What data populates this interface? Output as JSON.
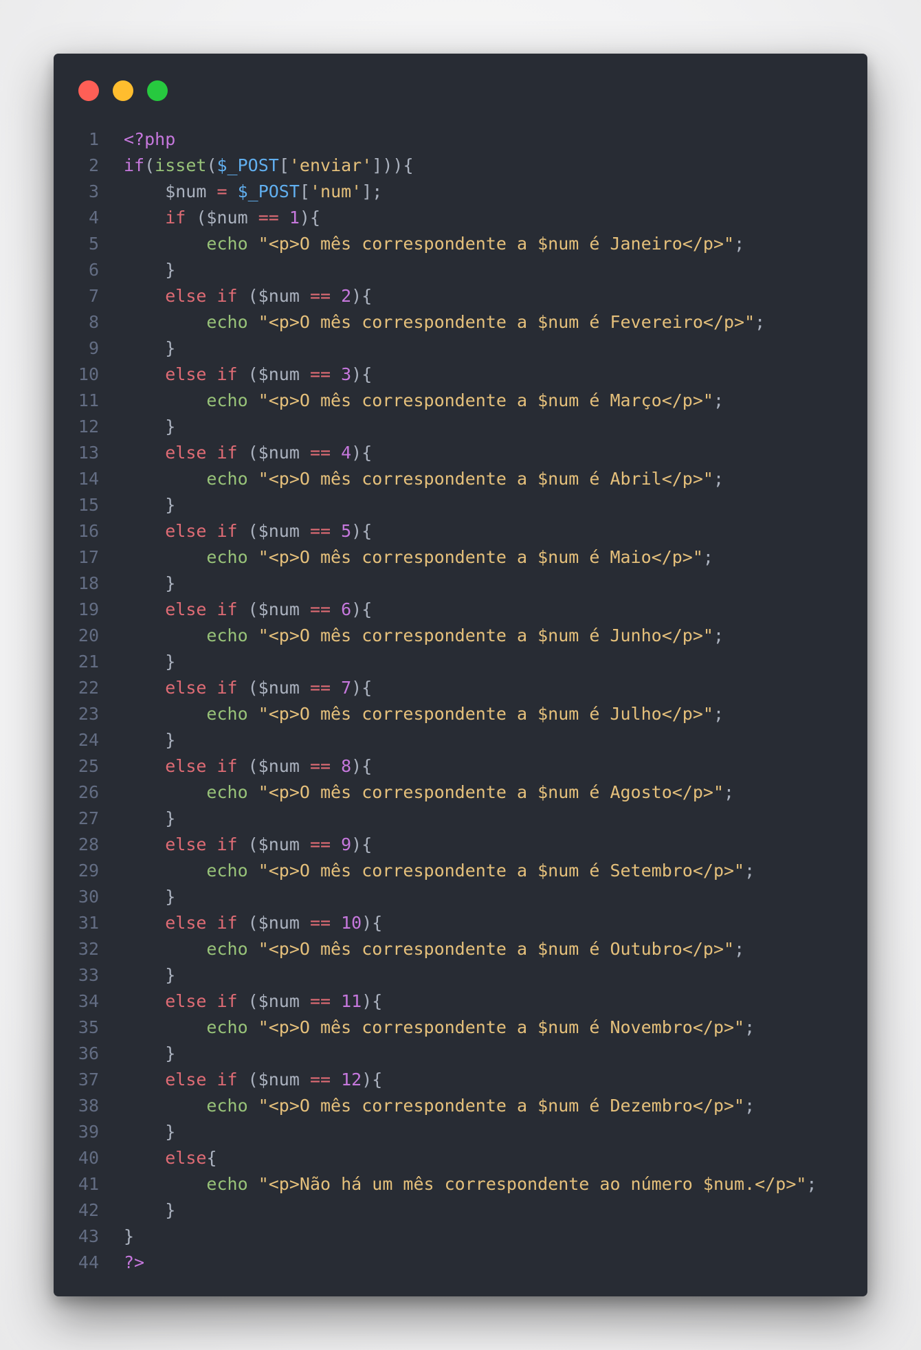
{
  "window": {
    "controls": [
      {
        "name": "close",
        "color": "#ff5f56"
      },
      {
        "name": "minimize",
        "color": "#ffbd2e"
      },
      {
        "name": "maximize",
        "color": "#27c93f"
      }
    ]
  },
  "code": {
    "lines": [
      {
        "n": "1",
        "tokens": [
          {
            "t": "<?php",
            "c": "purple"
          }
        ]
      },
      {
        "n": "2",
        "tokens": [
          {
            "t": "if",
            "c": "purple"
          },
          {
            "t": "(",
            "c": "plain"
          },
          {
            "t": "isset",
            "c": "fn"
          },
          {
            "t": "(",
            "c": "plain"
          },
          {
            "t": "$_POST",
            "c": "var"
          },
          {
            "t": "[",
            "c": "plain"
          },
          {
            "t": "'enviar'",
            "c": "str"
          },
          {
            "t": "])){",
            "c": "plain"
          }
        ]
      },
      {
        "n": "3",
        "tokens": [
          {
            "t": "    $num ",
            "c": "plain"
          },
          {
            "t": "=",
            "c": "kw"
          },
          {
            "t": " ",
            "c": "plain"
          },
          {
            "t": "$_POST",
            "c": "var"
          },
          {
            "t": "[",
            "c": "plain"
          },
          {
            "t": "'num'",
            "c": "str"
          },
          {
            "t": "];",
            "c": "plain"
          }
        ]
      },
      {
        "n": "4",
        "tokens": [
          {
            "t": "    ",
            "c": "plain"
          },
          {
            "t": "if",
            "c": "kw"
          },
          {
            "t": " ($num ",
            "c": "plain"
          },
          {
            "t": "==",
            "c": "kw"
          },
          {
            "t": " ",
            "c": "plain"
          },
          {
            "t": "1",
            "c": "num"
          },
          {
            "t": "){",
            "c": "plain"
          }
        ]
      },
      {
        "n": "5",
        "tokens": [
          {
            "t": "        ",
            "c": "plain"
          },
          {
            "t": "echo",
            "c": "fn"
          },
          {
            "t": " ",
            "c": "plain"
          },
          {
            "t": "\"<p>O mês correspondente a $num é Janeiro</p>\"",
            "c": "str"
          },
          {
            "t": ";",
            "c": "plain"
          }
        ]
      },
      {
        "n": "6",
        "tokens": [
          {
            "t": "    }",
            "c": "plain"
          }
        ]
      },
      {
        "n": "7",
        "tokens": [
          {
            "t": "    ",
            "c": "plain"
          },
          {
            "t": "else if",
            "c": "kw"
          },
          {
            "t": " ($num ",
            "c": "plain"
          },
          {
            "t": "==",
            "c": "kw"
          },
          {
            "t": " ",
            "c": "plain"
          },
          {
            "t": "2",
            "c": "num"
          },
          {
            "t": "){",
            "c": "plain"
          }
        ]
      },
      {
        "n": "8",
        "tokens": [
          {
            "t": "        ",
            "c": "plain"
          },
          {
            "t": "echo",
            "c": "fn"
          },
          {
            "t": " ",
            "c": "plain"
          },
          {
            "t": "\"<p>O mês correspondente a $num é Fevereiro</p>\"",
            "c": "str"
          },
          {
            "t": ";",
            "c": "plain"
          }
        ]
      },
      {
        "n": "9",
        "tokens": [
          {
            "t": "    }",
            "c": "plain"
          }
        ]
      },
      {
        "n": "10",
        "tokens": [
          {
            "t": "    ",
            "c": "plain"
          },
          {
            "t": "else if",
            "c": "kw"
          },
          {
            "t": " ($num ",
            "c": "plain"
          },
          {
            "t": "==",
            "c": "kw"
          },
          {
            "t": " ",
            "c": "plain"
          },
          {
            "t": "3",
            "c": "num"
          },
          {
            "t": "){",
            "c": "plain"
          }
        ]
      },
      {
        "n": "11",
        "tokens": [
          {
            "t": "        ",
            "c": "plain"
          },
          {
            "t": "echo",
            "c": "fn"
          },
          {
            "t": " ",
            "c": "plain"
          },
          {
            "t": "\"<p>O mês correspondente a $num é Março</p>\"",
            "c": "str"
          },
          {
            "t": ";",
            "c": "plain"
          }
        ]
      },
      {
        "n": "12",
        "tokens": [
          {
            "t": "    }",
            "c": "plain"
          }
        ]
      },
      {
        "n": "13",
        "tokens": [
          {
            "t": "    ",
            "c": "plain"
          },
          {
            "t": "else if",
            "c": "kw"
          },
          {
            "t": " ($num ",
            "c": "plain"
          },
          {
            "t": "==",
            "c": "kw"
          },
          {
            "t": " ",
            "c": "plain"
          },
          {
            "t": "4",
            "c": "num"
          },
          {
            "t": "){",
            "c": "plain"
          }
        ]
      },
      {
        "n": "14",
        "tokens": [
          {
            "t": "        ",
            "c": "plain"
          },
          {
            "t": "echo",
            "c": "fn"
          },
          {
            "t": " ",
            "c": "plain"
          },
          {
            "t": "\"<p>O mês correspondente a $num é Abril</p>\"",
            "c": "str"
          },
          {
            "t": ";",
            "c": "plain"
          }
        ]
      },
      {
        "n": "15",
        "tokens": [
          {
            "t": "    }",
            "c": "plain"
          }
        ]
      },
      {
        "n": "16",
        "tokens": [
          {
            "t": "    ",
            "c": "plain"
          },
          {
            "t": "else if",
            "c": "kw"
          },
          {
            "t": " ($num ",
            "c": "plain"
          },
          {
            "t": "==",
            "c": "kw"
          },
          {
            "t": " ",
            "c": "plain"
          },
          {
            "t": "5",
            "c": "num"
          },
          {
            "t": "){",
            "c": "plain"
          }
        ]
      },
      {
        "n": "17",
        "tokens": [
          {
            "t": "        ",
            "c": "plain"
          },
          {
            "t": "echo",
            "c": "fn"
          },
          {
            "t": " ",
            "c": "plain"
          },
          {
            "t": "\"<p>O mês correspondente a $num é Maio</p>\"",
            "c": "str"
          },
          {
            "t": ";",
            "c": "plain"
          }
        ]
      },
      {
        "n": "18",
        "tokens": [
          {
            "t": "    }",
            "c": "plain"
          }
        ]
      },
      {
        "n": "19",
        "tokens": [
          {
            "t": "    ",
            "c": "plain"
          },
          {
            "t": "else if",
            "c": "kw"
          },
          {
            "t": " ($num ",
            "c": "plain"
          },
          {
            "t": "==",
            "c": "kw"
          },
          {
            "t": " ",
            "c": "plain"
          },
          {
            "t": "6",
            "c": "num"
          },
          {
            "t": "){",
            "c": "plain"
          }
        ]
      },
      {
        "n": "20",
        "tokens": [
          {
            "t": "        ",
            "c": "plain"
          },
          {
            "t": "echo",
            "c": "fn"
          },
          {
            "t": " ",
            "c": "plain"
          },
          {
            "t": "\"<p>O mês correspondente a $num é Junho</p>\"",
            "c": "str"
          },
          {
            "t": ";",
            "c": "plain"
          }
        ]
      },
      {
        "n": "21",
        "tokens": [
          {
            "t": "    }",
            "c": "plain"
          }
        ]
      },
      {
        "n": "22",
        "tokens": [
          {
            "t": "    ",
            "c": "plain"
          },
          {
            "t": "else if",
            "c": "kw"
          },
          {
            "t": " ($num ",
            "c": "plain"
          },
          {
            "t": "==",
            "c": "kw"
          },
          {
            "t": " ",
            "c": "plain"
          },
          {
            "t": "7",
            "c": "num"
          },
          {
            "t": "){",
            "c": "plain"
          }
        ]
      },
      {
        "n": "23",
        "tokens": [
          {
            "t": "        ",
            "c": "plain"
          },
          {
            "t": "echo",
            "c": "fn"
          },
          {
            "t": " ",
            "c": "plain"
          },
          {
            "t": "\"<p>O mês correspondente a $num é Julho</p>\"",
            "c": "str"
          },
          {
            "t": ";",
            "c": "plain"
          }
        ]
      },
      {
        "n": "24",
        "tokens": [
          {
            "t": "    }",
            "c": "plain"
          }
        ]
      },
      {
        "n": "25",
        "tokens": [
          {
            "t": "    ",
            "c": "plain"
          },
          {
            "t": "else if",
            "c": "kw"
          },
          {
            "t": " ($num ",
            "c": "plain"
          },
          {
            "t": "==",
            "c": "kw"
          },
          {
            "t": " ",
            "c": "plain"
          },
          {
            "t": "8",
            "c": "num"
          },
          {
            "t": "){",
            "c": "plain"
          }
        ]
      },
      {
        "n": "26",
        "tokens": [
          {
            "t": "        ",
            "c": "plain"
          },
          {
            "t": "echo",
            "c": "fn"
          },
          {
            "t": " ",
            "c": "plain"
          },
          {
            "t": "\"<p>O mês correspondente a $num é Agosto</p>\"",
            "c": "str"
          },
          {
            "t": ";",
            "c": "plain"
          }
        ]
      },
      {
        "n": "27",
        "tokens": [
          {
            "t": "    }",
            "c": "plain"
          }
        ]
      },
      {
        "n": "28",
        "tokens": [
          {
            "t": "    ",
            "c": "plain"
          },
          {
            "t": "else if",
            "c": "kw"
          },
          {
            "t": " ($num ",
            "c": "plain"
          },
          {
            "t": "==",
            "c": "kw"
          },
          {
            "t": " ",
            "c": "plain"
          },
          {
            "t": "9",
            "c": "num"
          },
          {
            "t": "){",
            "c": "plain"
          }
        ]
      },
      {
        "n": "29",
        "tokens": [
          {
            "t": "        ",
            "c": "plain"
          },
          {
            "t": "echo",
            "c": "fn"
          },
          {
            "t": " ",
            "c": "plain"
          },
          {
            "t": "\"<p>O mês correspondente a $num é Setembro</p>\"",
            "c": "str"
          },
          {
            "t": ";",
            "c": "plain"
          }
        ]
      },
      {
        "n": "30",
        "tokens": [
          {
            "t": "    }",
            "c": "plain"
          }
        ]
      },
      {
        "n": "31",
        "tokens": [
          {
            "t": "    ",
            "c": "plain"
          },
          {
            "t": "else if",
            "c": "kw"
          },
          {
            "t": " ($num ",
            "c": "plain"
          },
          {
            "t": "==",
            "c": "kw"
          },
          {
            "t": " ",
            "c": "plain"
          },
          {
            "t": "10",
            "c": "num"
          },
          {
            "t": "){",
            "c": "plain"
          }
        ]
      },
      {
        "n": "32",
        "tokens": [
          {
            "t": "        ",
            "c": "plain"
          },
          {
            "t": "echo",
            "c": "fn"
          },
          {
            "t": " ",
            "c": "plain"
          },
          {
            "t": "\"<p>O mês correspondente a $num é Outubro</p>\"",
            "c": "str"
          },
          {
            "t": ";",
            "c": "plain"
          }
        ]
      },
      {
        "n": "33",
        "tokens": [
          {
            "t": "    }",
            "c": "plain"
          }
        ]
      },
      {
        "n": "34",
        "tokens": [
          {
            "t": "    ",
            "c": "plain"
          },
          {
            "t": "else if",
            "c": "kw"
          },
          {
            "t": " ($num ",
            "c": "plain"
          },
          {
            "t": "==",
            "c": "kw"
          },
          {
            "t": " ",
            "c": "plain"
          },
          {
            "t": "11",
            "c": "num"
          },
          {
            "t": "){",
            "c": "plain"
          }
        ]
      },
      {
        "n": "35",
        "tokens": [
          {
            "t": "        ",
            "c": "plain"
          },
          {
            "t": "echo",
            "c": "fn"
          },
          {
            "t": " ",
            "c": "plain"
          },
          {
            "t": "\"<p>O mês correspondente a $num é Novembro</p>\"",
            "c": "str"
          },
          {
            "t": ";",
            "c": "plain"
          }
        ]
      },
      {
        "n": "36",
        "tokens": [
          {
            "t": "    }",
            "c": "plain"
          }
        ]
      },
      {
        "n": "37",
        "tokens": [
          {
            "t": "    ",
            "c": "plain"
          },
          {
            "t": "else if",
            "c": "kw"
          },
          {
            "t": " ($num ",
            "c": "plain"
          },
          {
            "t": "==",
            "c": "kw"
          },
          {
            "t": " ",
            "c": "plain"
          },
          {
            "t": "12",
            "c": "num"
          },
          {
            "t": "){",
            "c": "plain"
          }
        ]
      },
      {
        "n": "38",
        "tokens": [
          {
            "t": "        ",
            "c": "plain"
          },
          {
            "t": "echo",
            "c": "fn"
          },
          {
            "t": " ",
            "c": "plain"
          },
          {
            "t": "\"<p>O mês correspondente a $num é Dezembro</p>\"",
            "c": "str"
          },
          {
            "t": ";",
            "c": "plain"
          }
        ]
      },
      {
        "n": "39",
        "tokens": [
          {
            "t": "    }",
            "c": "plain"
          }
        ]
      },
      {
        "n": "40",
        "tokens": [
          {
            "t": "    ",
            "c": "plain"
          },
          {
            "t": "else",
            "c": "kw"
          },
          {
            "t": "{",
            "c": "plain"
          }
        ]
      },
      {
        "n": "41",
        "tokens": [
          {
            "t": "        ",
            "c": "plain"
          },
          {
            "t": "echo",
            "c": "fn"
          },
          {
            "t": " ",
            "c": "plain"
          },
          {
            "t": "\"<p>Não há um mês correspondente ao número $num.</p>\"",
            "c": "str"
          },
          {
            "t": ";",
            "c": "plain"
          }
        ]
      },
      {
        "n": "42",
        "tokens": [
          {
            "t": "    }",
            "c": "plain"
          }
        ]
      },
      {
        "n": "43",
        "tokens": [
          {
            "t": "}",
            "c": "plain"
          }
        ]
      },
      {
        "n": "44",
        "tokens": [
          {
            "t": "?>",
            "c": "purple"
          }
        ]
      }
    ]
  }
}
